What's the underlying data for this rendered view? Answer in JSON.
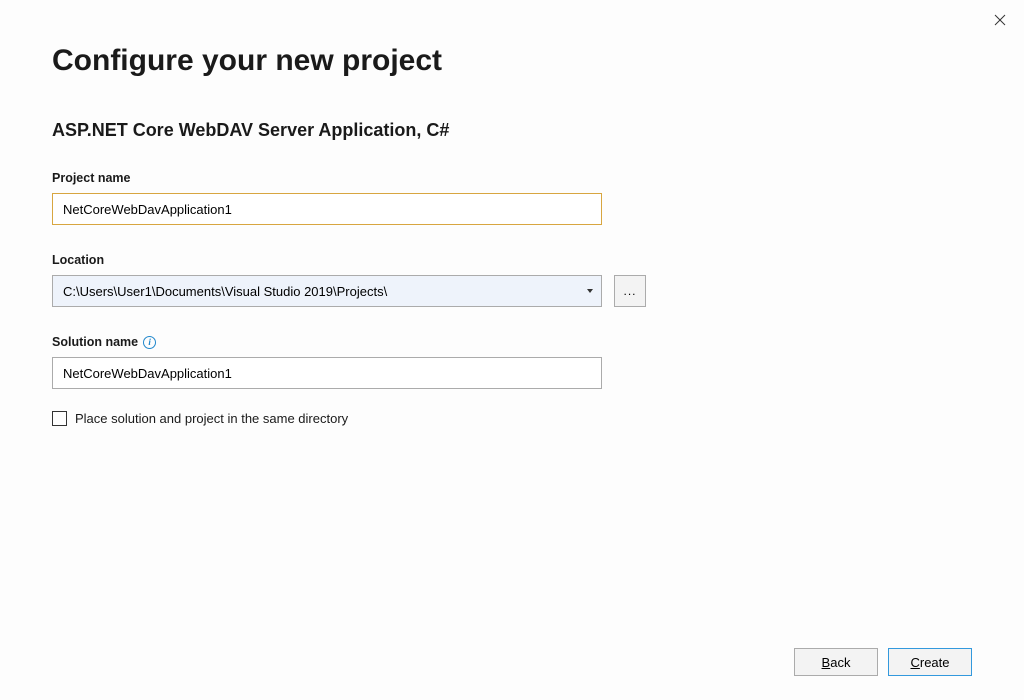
{
  "header": {
    "title": "Configure your new project",
    "subtitle": "ASP.NET Core WebDAV Server Application, C#"
  },
  "fields": {
    "project_name_label": "Project name",
    "project_name_value": "NetCoreWebDavApplication1",
    "location_label": "Location",
    "location_value": "C:\\Users\\User1\\Documents\\Visual Studio 2019\\Projects\\",
    "browse_label": "...",
    "solution_name_label": "Solution name ",
    "solution_name_value": "NetCoreWebDavApplication1",
    "checkbox_label": "Place solution and project in the same directory"
  },
  "footer": {
    "back_label": "Back",
    "create_label": "Create"
  }
}
